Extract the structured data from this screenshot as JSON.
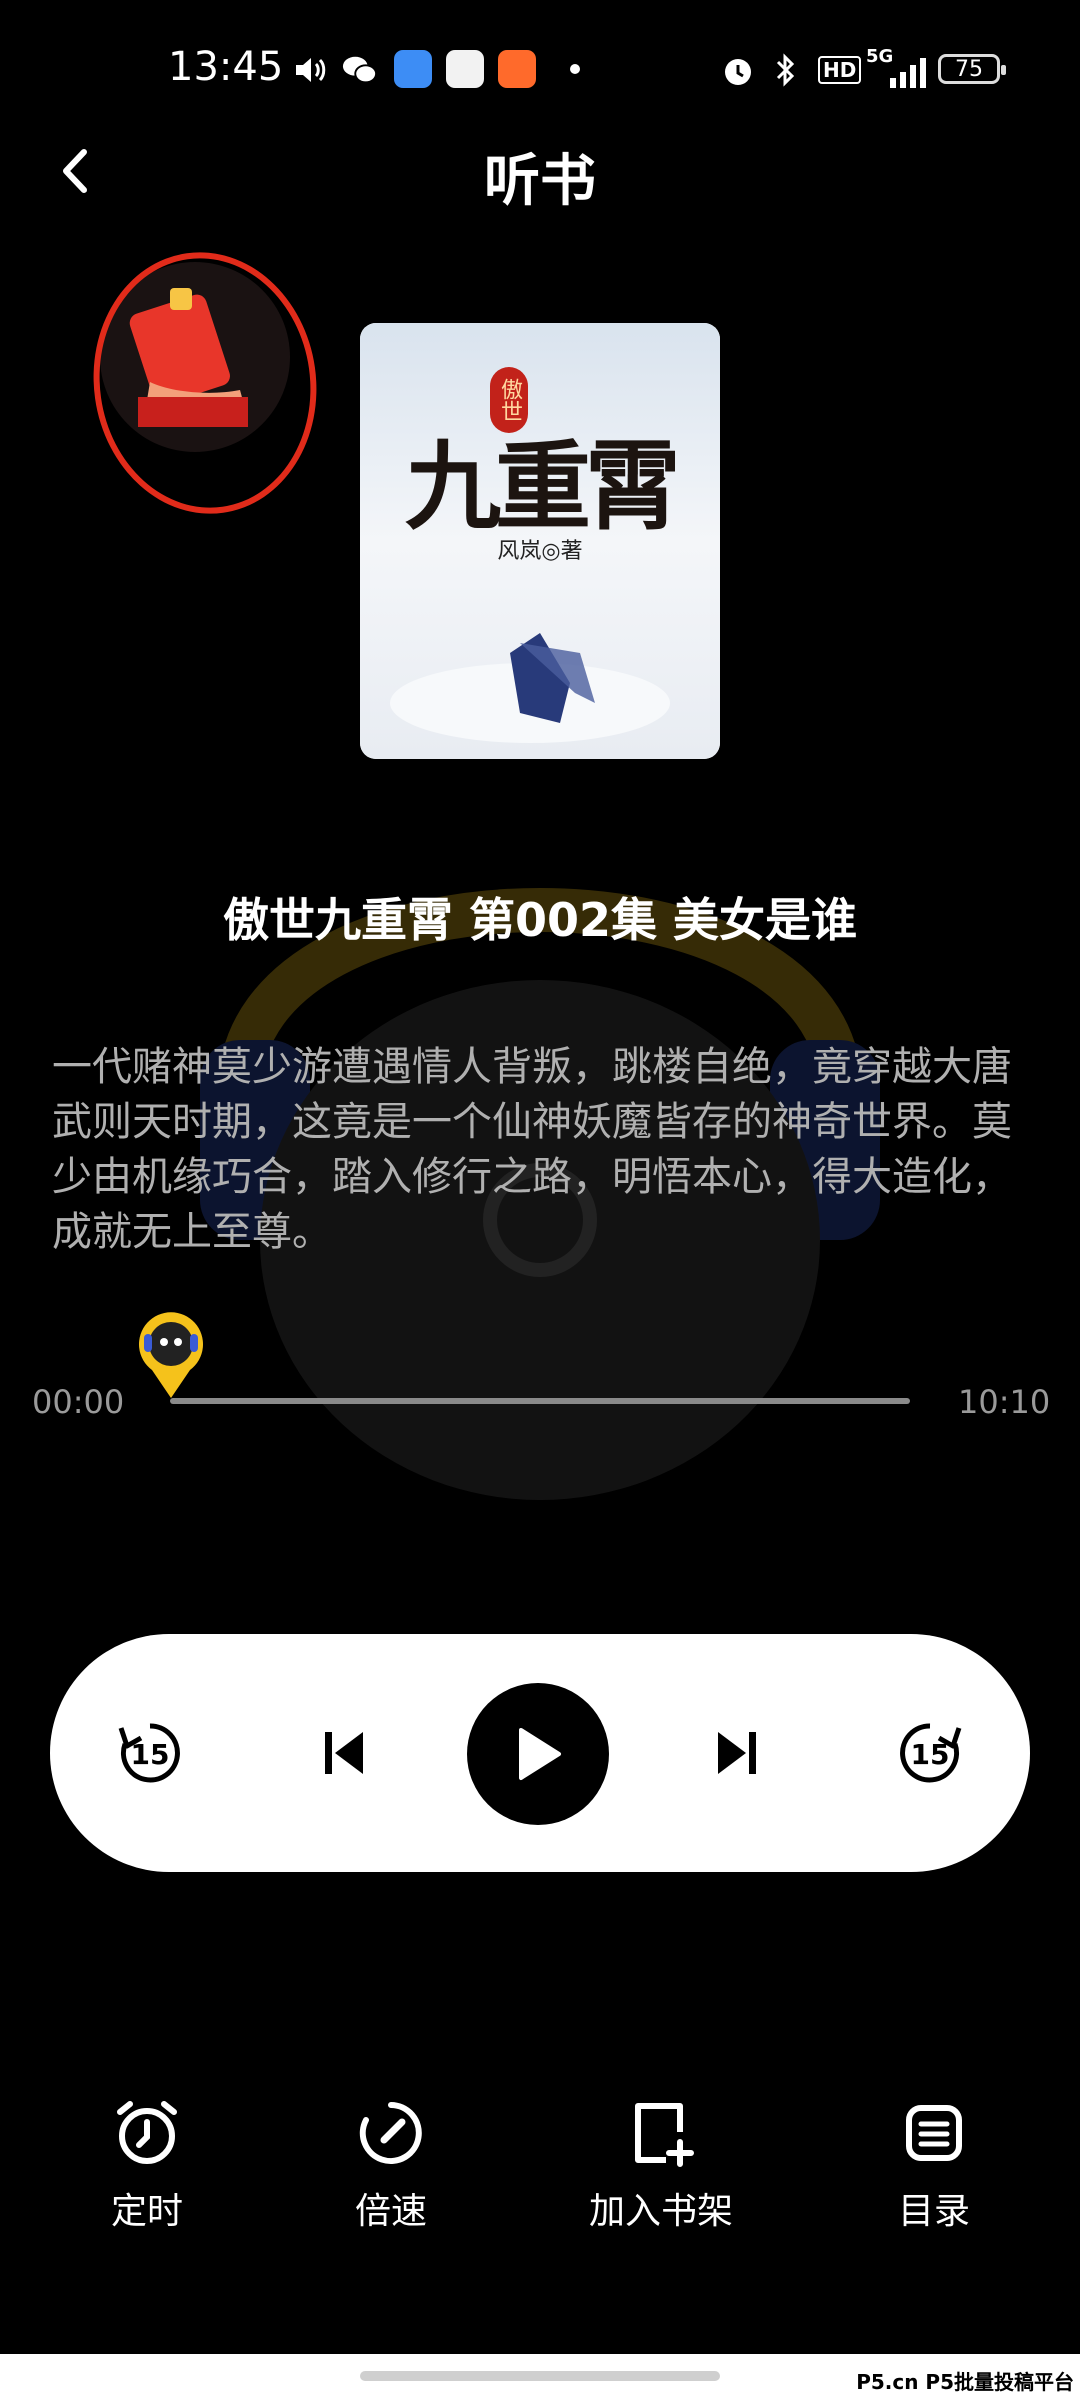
{
  "status_bar": {
    "time": "13:45",
    "network": "5G",
    "hd_label": "HD",
    "battery": "75"
  },
  "header": {
    "title": "听书",
    "back_icon": "chevron-left-icon"
  },
  "book": {
    "cover_title": "九重霄",
    "cover_prefix": "傲世",
    "cover_author": "风岚◎著"
  },
  "episode_title": "傲世九重霄 第002集 美女是谁",
  "description": "一代赌神莫少游遭遇情人背叛，跳楼自绝，竟穿越大唐武则天时期，这竟是一个仙神妖魔皆存的神奇世界。莫少由机缘巧合，踏入修行之路，明悟本心，得大造化，成就无上至尊。",
  "player": {
    "current_time": "00:00",
    "total_time": "10:10",
    "progress": 0.0,
    "rewind_label": "15",
    "forward_label": "15"
  },
  "actions": [
    {
      "label": "定时",
      "icon": "alarm-clock-icon"
    },
    {
      "label": "倍速",
      "icon": "speed-gauge-icon"
    },
    {
      "label": "加入书架",
      "icon": "add-bookshelf-icon"
    },
    {
      "label": "目录",
      "icon": "catalog-list-icon"
    }
  ],
  "watermark": "P5.cn P5批量投稿平台",
  "colors": {
    "background": "#000000",
    "accent_red": "#e12b1a",
    "thumb_yellow": "#f5c21b",
    "pill": "#ffffff"
  }
}
